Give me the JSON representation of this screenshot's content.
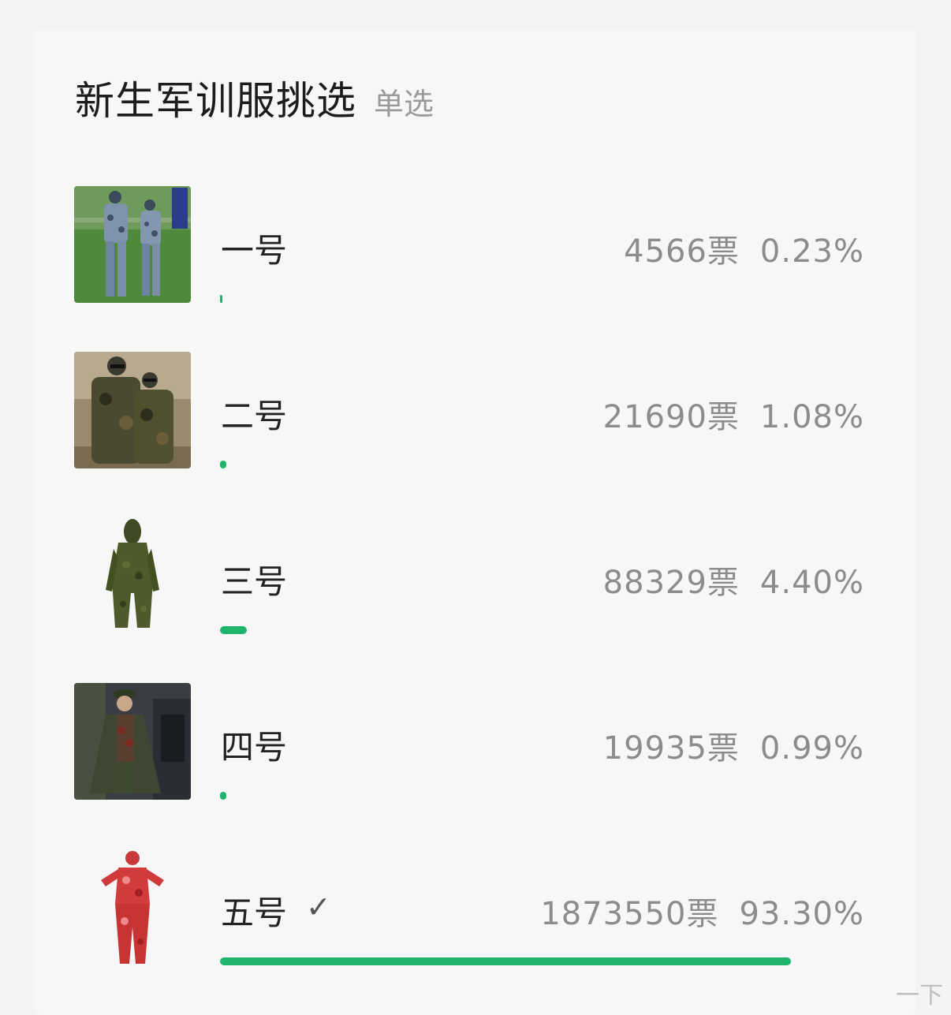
{
  "poll": {
    "title": "新生军训服挑选",
    "mode": "单选",
    "vote_unit": "票",
    "accent_color": "#21b46c",
    "options": [
      {
        "label": "一号",
        "votes": "4566",
        "percent": "0.23%",
        "share": 0.0023,
        "selected": false,
        "image": "two-people-blue-camouflage-photo"
      },
      {
        "label": "二号",
        "votes": "21690",
        "percent": "1.08%",
        "share": 0.0108,
        "selected": false,
        "image": "two-people-woodland-camouflage-photo"
      },
      {
        "label": "三号",
        "votes": "88329",
        "percent": "4.40%",
        "share": 0.044,
        "selected": false,
        "image": "ghillie-suit-photo"
      },
      {
        "label": "四号",
        "votes": "19935",
        "percent": "0.99%",
        "share": 0.0099,
        "selected": false,
        "image": "person-military-cape-photo"
      },
      {
        "label": "五号",
        "votes": "1873550",
        "percent": "93.30%",
        "share": 0.933,
        "selected": true,
        "check_icon": "checkmark-icon",
        "image": "red-camouflage-suit-photo"
      }
    ]
  },
  "watermark": "一下"
}
